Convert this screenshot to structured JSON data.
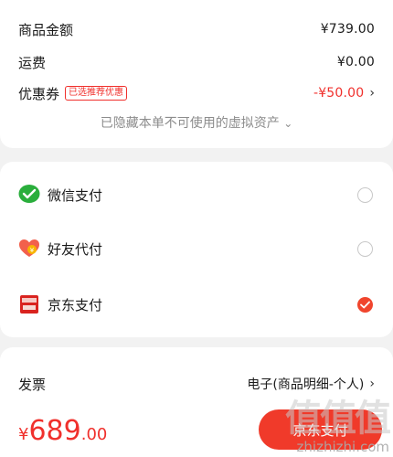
{
  "summary": {
    "goods_label": "商品金额",
    "goods_value": "¥739.00",
    "shipping_label": "运费",
    "shipping_value": "¥0.00",
    "coupon_label": "优惠券",
    "coupon_tag": "已选推荐优惠",
    "coupon_value": "-¥50.00",
    "hidden_assets": "已隐藏本单不可使用的虚拟资产"
  },
  "payment": {
    "options": [
      {
        "label": "微信支付",
        "icon": "wechat-pay-icon",
        "selected": false
      },
      {
        "label": "好友代付",
        "icon": "friend-pay-icon",
        "selected": false
      },
      {
        "label": "京东支付",
        "icon": "jd-pay-icon",
        "selected": true
      }
    ]
  },
  "invoice": {
    "label": "发票",
    "value": "电子(商品明细-个人)"
  },
  "total": {
    "currency": "¥",
    "integer": "689",
    "decimal": ".00"
  },
  "pay_button": "京东支付",
  "watermark": {
    "cn": "值值值",
    "url": "zhizhizhi.com"
  },
  "colors": {
    "accent": "#f0302c",
    "wechat": "#2aae3c",
    "background": "#f2f2f2"
  }
}
